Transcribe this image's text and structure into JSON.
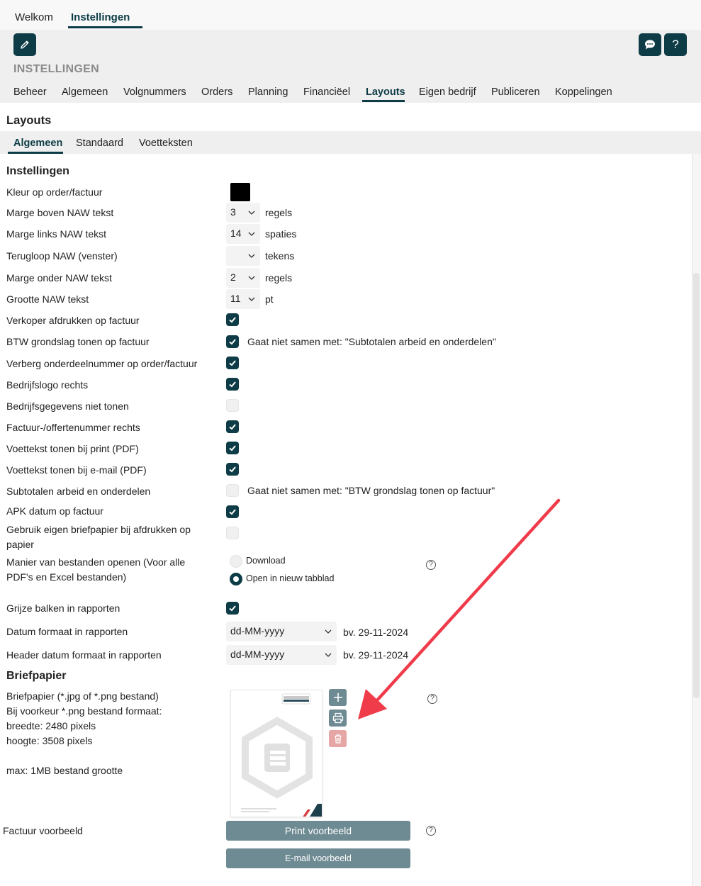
{
  "top_tabs": [
    "Welkom",
    "Instellingen"
  ],
  "page_title": "INSTELLINGEN",
  "nav_tabs": [
    "Beheer",
    "Algemeen",
    "Volgnummers",
    "Orders",
    "Planning",
    "Financiëel",
    "Layouts",
    "Eigen bedrijf",
    "Publiceren",
    "Koppelingen"
  ],
  "active_nav": "Layouts",
  "section_title": "Layouts",
  "sub_tabs": [
    "Algemeen",
    "Standaard",
    "Voetteksten"
  ],
  "settings_heading": "Instellingen",
  "settings": {
    "color": {
      "label": "Kleur op order/factuur",
      "value": "#000000"
    },
    "margin_top": {
      "label": "Marge boven NAW tekst",
      "value": "3",
      "unit": "regels"
    },
    "margin_left": {
      "label": "Marge links NAW tekst",
      "value": "14",
      "unit": "spaties"
    },
    "wrap": {
      "label": "Terugloop NAW (venster)",
      "value": "",
      "unit": "tekens"
    },
    "margin_bottom": {
      "label": "Marge onder NAW tekst",
      "value": "2",
      "unit": "regels"
    },
    "size": {
      "label": "Grootte NAW tekst",
      "value": "11",
      "unit": "pt"
    },
    "cb_seller": {
      "label": "Verkoper afdrukken op factuur",
      "checked": true
    },
    "cb_vat": {
      "label": "BTW grondslag tonen op factuur",
      "checked": true,
      "note": "Gaat niet samen met: \"Subtotalen arbeid en onderdelen\""
    },
    "cb_partnr": {
      "label": "Verberg onderdeelnummer op order/factuur",
      "checked": true
    },
    "cb_logo": {
      "label": "Bedrijfslogo rechts",
      "checked": true
    },
    "cb_company": {
      "label": "Bedrijfsgegevens niet tonen",
      "checked": false
    },
    "cb_invno": {
      "label": "Factuur-/offertenummer rechts",
      "checked": true
    },
    "cb_footer_print": {
      "label": "Voettekst tonen bij print (PDF)",
      "checked": true
    },
    "cb_footer_mail": {
      "label": "Voettekst tonen bij e-mail (PDF)",
      "checked": true
    },
    "cb_subtotals": {
      "label": "Subtotalen arbeid en onderdelen",
      "checked": false,
      "note": "Gaat niet samen met: \"BTW grondslag tonen op factuur\""
    },
    "cb_apk": {
      "label": "APK datum op factuur",
      "checked": true
    },
    "cb_own_paper": {
      "label": "Gebruik eigen briefpapier bij afdrukken op papier",
      "checked": false
    },
    "open_files": {
      "label": "Manier van bestanden openen (Voor alle PDF's en Excel bestanden)",
      "options": [
        "Download",
        "Open in nieuw tabblad"
      ],
      "selected": "Open in nieuw tabblad"
    },
    "cb_grey_bars": {
      "label": "Grijze balken in rapporten",
      "checked": true
    },
    "date_format": {
      "label": "Datum formaat in rapporten",
      "value": "dd-MM-yyyy",
      "example": "bv. 29-11-2024"
    },
    "header_date_format": {
      "label": "Header datum formaat in rapporten",
      "value": "dd-MM-yyyy",
      "example": "bv. 29-11-2024"
    }
  },
  "stationery": {
    "heading": "Briefpapier",
    "info": [
      "Briefpapier (*.jpg of *.png bestand)",
      "Bij voorkeur *.png bestand formaat:",
      "breedte: 2480 pixels",
      "hoogte: 3508 pixels",
      "max: 1MB bestand grootte"
    ]
  },
  "preview": {
    "label": "Factuur voorbeeld",
    "print_button": "Print voorbeeld",
    "email_button": "E-mail voorbeeld"
  },
  "help_glyph": "?",
  "colors": {
    "accent": "#0d3c46",
    "button_grey": "#6e8a92",
    "delete_red": "#e7a6a6",
    "annotation": "#ef3b4a"
  }
}
